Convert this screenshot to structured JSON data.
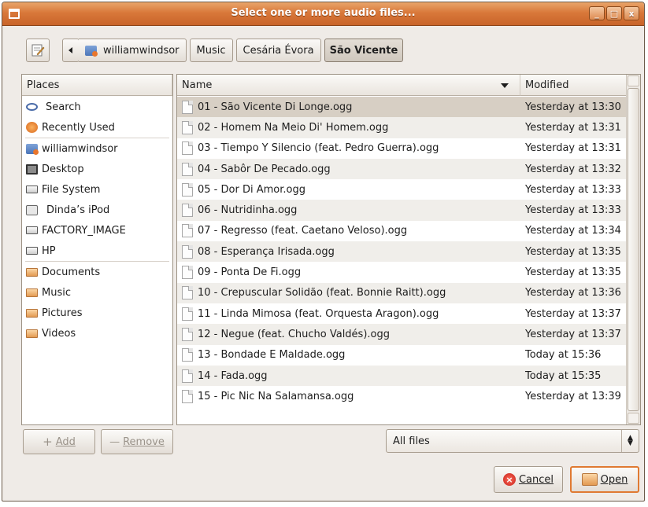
{
  "window": {
    "title": "Select one or more audio files..."
  },
  "titlebar_controls": [
    "_",
    "□",
    "x"
  ],
  "pathbar": {
    "crumbs": [
      {
        "label": "williamwindsor",
        "icon": "home-folder-icon"
      },
      {
        "label": "Music"
      },
      {
        "label": "Cesária Évora"
      },
      {
        "label": "São Vicente",
        "active": true
      }
    ]
  },
  "places": {
    "header": "Places",
    "groups": [
      [
        {
          "label": "Search",
          "icon": "search-icon"
        },
        {
          "label": "Recently Used",
          "icon": "recent-icon"
        }
      ],
      [
        {
          "label": "williamwindsor",
          "icon": "home-folder-icon"
        },
        {
          "label": "Desktop",
          "icon": "desktop-icon"
        },
        {
          "label": "File System",
          "icon": "drive-icon"
        },
        {
          "label": "Dinda’s iPod",
          "icon": "ipod-icon"
        },
        {
          "label": "FACTORY_IMAGE",
          "icon": "drive-icon"
        },
        {
          "label": "HP",
          "icon": "drive-icon"
        }
      ],
      [
        {
          "label": "Documents",
          "icon": "folder-icon"
        },
        {
          "label": "Music",
          "icon": "folder-icon"
        },
        {
          "label": "Pictures",
          "icon": "folder-icon"
        },
        {
          "label": "Videos",
          "icon": "folder-icon"
        }
      ]
    ]
  },
  "files": {
    "columns": {
      "name": "Name",
      "modified": "Modified"
    },
    "rows": [
      {
        "name": "01 - São Vicente Di Longe.ogg",
        "modified": "Yesterday at 13:30",
        "selected": true
      },
      {
        "name": "02 - Homem Na Meio Di' Homem.ogg",
        "modified": "Yesterday at 13:31"
      },
      {
        "name": "03 - Tiempo Y Silencio (feat. Pedro Guerra).ogg",
        "modified": "Yesterday at 13:31"
      },
      {
        "name": "04 - Sabôr De Pecado.ogg",
        "modified": "Yesterday at 13:32"
      },
      {
        "name": "05 - Dor Di Amor.ogg",
        "modified": "Yesterday at 13:33"
      },
      {
        "name": "06 - Nutridinha.ogg",
        "modified": "Yesterday at 13:33"
      },
      {
        "name": "07 - Regresso (feat. Caetano Veloso).ogg",
        "modified": "Yesterday at 13:34"
      },
      {
        "name": "08 - Esperança Irisada.ogg",
        "modified": "Yesterday at 13:35"
      },
      {
        "name": "09 - Ponta De Fi.ogg",
        "modified": "Yesterday at 13:35"
      },
      {
        "name": "10 - Crepuscular Solidão (feat. Bonnie Raitt).ogg",
        "modified": "Yesterday at 13:36"
      },
      {
        "name": "11 - Linda Mimosa (feat. Orquesta Aragon).ogg",
        "modified": "Yesterday at 13:37"
      },
      {
        "name": "12 - Negue (feat. Chucho Valdés).ogg",
        "modified": "Yesterday at 13:37"
      },
      {
        "name": "13 - Bondade E Maldade.ogg",
        "modified": "Today at 15:36"
      },
      {
        "name": "14 - Fada.ogg",
        "modified": "Today at 15:35"
      },
      {
        "name": "15 - Pic Nic Na Salamansa.ogg",
        "modified": "Yesterday at 13:39"
      }
    ]
  },
  "buttons": {
    "add": "Add",
    "remove": "Remove",
    "cancel": "Cancel",
    "open": "Open"
  },
  "filter": {
    "selected": "All files"
  },
  "colors": {
    "titlebar": "#d9783a",
    "accent": "#e07a32",
    "selected_row": "#d7cfc4"
  }
}
